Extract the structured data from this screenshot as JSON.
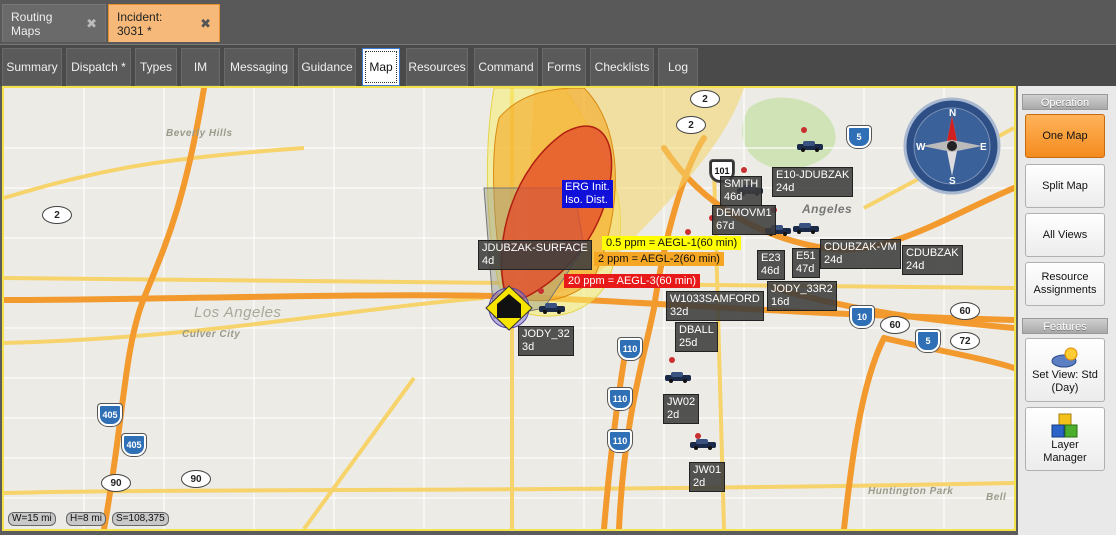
{
  "doc_tabs": [
    {
      "label": "Routing Maps",
      "close": "✖"
    },
    {
      "label": "Incident: 3031 *",
      "close": "✖"
    }
  ],
  "sub_tabs": [
    "Summary",
    "Dispatch *",
    "Types",
    "IM",
    "Messaging",
    "Guidance",
    "Map",
    "Resources",
    "Command",
    "Forms",
    "Checklists",
    "Log"
  ],
  "active_sub_tab": "Map",
  "map": {
    "places": {
      "beverly_hills": "Beverly Hills",
      "los_angeles_big": "Los Angeles",
      "culver_city": "Culver City",
      "angeles": "Angeles",
      "huntington_park": "Huntington Park",
      "bell": "Bell"
    },
    "erg_label": "ERG Init.\nIso. Dist.",
    "aegl": {
      "aegl1": "0.5 ppm = AEGL-1(60 min)",
      "aegl2": "2 ppm = AEGL-2(60 min)",
      "aegl3": "20 ppm = AEGL-3(60 min)"
    },
    "colors": {
      "aegl1": "#ffff00",
      "aegl2": "#f5a623",
      "aegl3": "#e81919",
      "erg": "#1010d8"
    },
    "units": {
      "jdubzak_surface": "JDUBZAK-SURFACE\n4d",
      "jody_32": "JODY_32\n3d",
      "smith": "SMITH\n46d",
      "e10": "E10-JDUBZAK\n24d",
      "demovm1": "DEMOVM1\n67d",
      "e23": "E23\n46d",
      "e51": "E51\n47d",
      "cdubzak_vm": "CDUBZAK-VM\n24d",
      "cdubzak": "CDUBZAK\n24d",
      "jody_33r2": "JODY_33R2\n16d",
      "w1033samford": "W1033SAMFORD\n32d",
      "dball": "DBALL\n25d",
      "jw02": "JW02\n2d",
      "jw01": "JW01\n2d"
    },
    "shields": {
      "s2a": "2",
      "s2b": "2",
      "s2c": "2",
      "s90a": "90",
      "s90b": "90",
      "s60a": "60",
      "s60b": "60",
      "s72": "72",
      "i405a": "405",
      "i405b": "405",
      "i110a": "110",
      "i110b": "110",
      "i110c": "110",
      "i10": "10",
      "i5a": "5",
      "i5b": "5",
      "us101": "101"
    },
    "scale": {
      "w": "W=15 mi",
      "h": "H=8 mi",
      "s": "S=108,375"
    }
  },
  "panel": {
    "operation_header": "Operation",
    "buttons": [
      "One Map",
      "Split Map",
      "All Views",
      "Resource\nAssignments"
    ],
    "features_header": "Features",
    "set_view": "Set View: Std\n(Day)",
    "layer_manager": "Layer\nManager"
  }
}
